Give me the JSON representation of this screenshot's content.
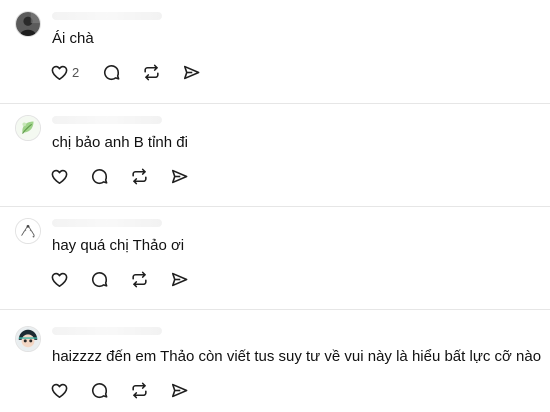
{
  "posts": [
    {
      "avatar_icon": "user-avatar-dark",
      "text": "Ái chà",
      "like_count": "2",
      "actions": [
        "heart-icon",
        "comment-icon",
        "repost-icon",
        "share-icon"
      ]
    },
    {
      "avatar_icon": "user-avatar-green-leaf",
      "text": "chị bảo anh B tỉnh đi",
      "like_count": "",
      "actions": [
        "heart-icon",
        "comment-icon",
        "repost-icon",
        "share-icon"
      ]
    },
    {
      "avatar_icon": "user-avatar-sketch",
      "text": "hay quá chị Thảo ơi",
      "like_count": "",
      "actions": [
        "heart-icon",
        "comment-icon",
        "repost-icon",
        "share-icon"
      ]
    },
    {
      "avatar_icon": "user-avatar-character",
      "text": "haizzzz đến em Thảo còn viết tus suy tư về vui này là hiểu bất lực cỡ nào",
      "like_count": "",
      "actions": [
        "heart-icon",
        "comment-icon",
        "repost-icon",
        "share-icon"
      ]
    }
  ],
  "colors": {
    "text": "#111111",
    "icon": "#1f1f1f",
    "divider": "#e6e6e6"
  }
}
